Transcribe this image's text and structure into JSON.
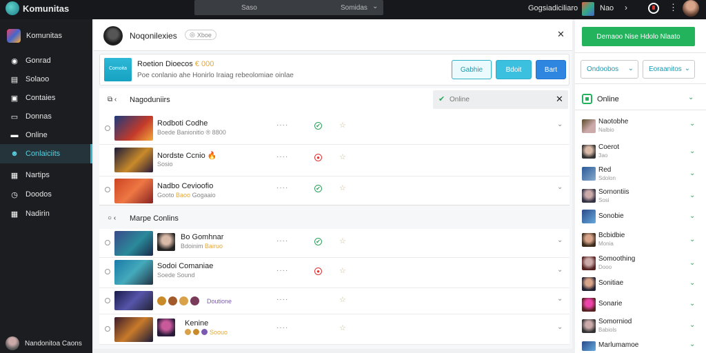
{
  "topbar": {
    "brand": "Komunitas",
    "search_placeholder": "Saso",
    "search_scope": "Somidas",
    "user_label": "Gogsiadiciliaro",
    "mode_label": "Nao"
  },
  "sidebar": {
    "title": "Komunitas",
    "items": [
      {
        "label": "Gonrad",
        "icon": "compass-icon"
      },
      {
        "label": "Solaoo",
        "icon": "book-icon"
      },
      {
        "label": "Contaies",
        "icon": "inbox-icon"
      },
      {
        "label": "Donnas",
        "icon": "mail-icon"
      },
      {
        "label": "Online",
        "icon": "folder-icon"
      },
      {
        "label": "Conlaiciits",
        "icon": "users-icon",
        "active": true
      },
      {
        "label": "Nartips",
        "icon": "calendar-icon"
      },
      {
        "label": "Doodos",
        "icon": "clock-icon"
      },
      {
        "label": "Nadirin",
        "icon": "grid-icon"
      }
    ],
    "footer": "Nandonitoa Caons"
  },
  "main": {
    "header_title": "Noqonilexies",
    "header_badge": "Xboe",
    "event": {
      "thumb_text": "Comoita",
      "title": "Roetion Dioecos",
      "title_extra": "€ 000",
      "description": "Poe conlanio ahe Honirlo Iraiag rebeolomiae oinlae",
      "btn_outline": "Gabhie",
      "btn_teal": "Bdoit",
      "btn_blue": "Bart"
    },
    "group1": {
      "label": "Nagoduniirs",
      "filter_label": "Online"
    },
    "group2": {
      "label": "Marpe Conlins"
    },
    "rows_group1": [
      {
        "name": "Rodboti Codhe",
        "sub": "Boede Banionitio ® 8800",
        "status": "ok",
        "star": "☆"
      },
      {
        "name": "Nordste Ccnio",
        "sub": "Sosio",
        "status": "bad",
        "star": "☆",
        "emoji": "🔥"
      },
      {
        "name": "Nadbo Cevioofio",
        "sub": "Gooto",
        "sub_extra": "Baoo",
        "sub_tail": "Gogaaio",
        "status": "ok",
        "star": "☆"
      }
    ],
    "rows_group2": [
      {
        "name": "Bo Gomhnar",
        "sub": "Bdoinim",
        "sub_extra": "Bairuo",
        "status": "ok",
        "star": "☆"
      },
      {
        "name": "Sodoi Comaniae",
        "sub": "Soede Sound",
        "status": "bad",
        "star": "☆"
      },
      {
        "name": "",
        "sub": "Doutione",
        "status": "",
        "star": "☆"
      },
      {
        "name": "Kenine",
        "sub": "Soouo",
        "status": "",
        "star": "☆"
      }
    ]
  },
  "right": {
    "cta": "Demaoo Nise Hdolo Nlaato",
    "select1": "Ondoobos",
    "select2": "Eoraanitos",
    "online_label": "Online",
    "friends": [
      {
        "name": "Naotobhe",
        "sub": "Nalbio"
      },
      {
        "name": "Coerot",
        "sub": "3ao"
      },
      {
        "name": "Red",
        "sub": "Sdolon"
      },
      {
        "name": "Sornontiis",
        "sub": "Sosi"
      },
      {
        "name": "Sonobie",
        "sub": ""
      },
      {
        "name": "Bcbidbie",
        "sub": "Monia"
      },
      {
        "name": "Somoothing",
        "sub": "Dooo"
      },
      {
        "name": "Sonitiae",
        "sub": ""
      },
      {
        "name": "Sonarie",
        "sub": ""
      },
      {
        "name": "Somorniod",
        "sub": "Babiols"
      },
      {
        "name": "Marlumamoe",
        "sub": ""
      }
    ]
  }
}
